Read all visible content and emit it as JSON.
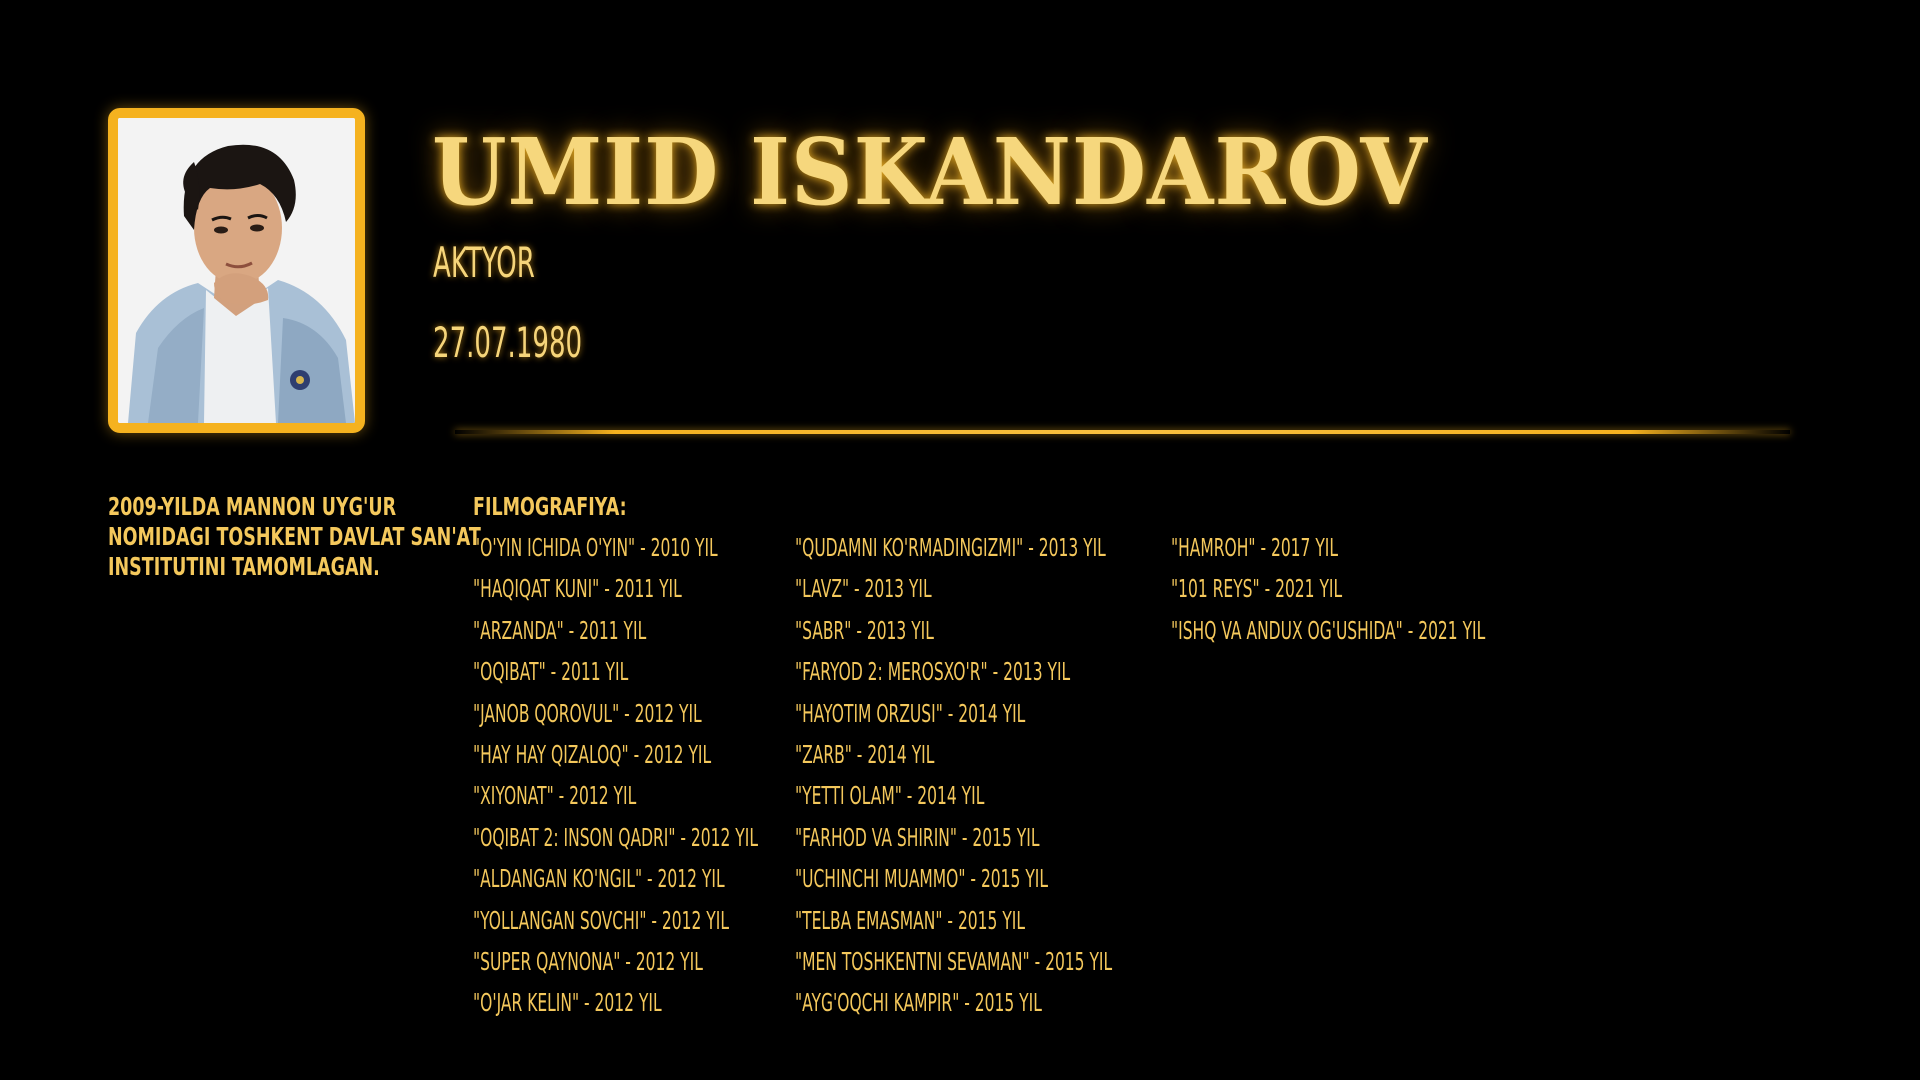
{
  "profile": {
    "name": "UMID ISKANDAROV",
    "role": "AKTYOR",
    "birth_date": "27.07.1980",
    "photo_icon": "portrait-photo"
  },
  "bio": {
    "lines": [
      "2009-YILDA MANNON UYG'UR",
      "NOMIDAGI TOSHKENT DAVLAT SAN'AT",
      "INSTITUTINI TAMOMLAGAN."
    ]
  },
  "filmography": {
    "title": "FILMOGRAFIYA:",
    "columns": [
      [
        "\"O'YIN ICHIDA O'YIN\" - 2010 YIL",
        "\"HAQIQAT KUNI\" - 2011 YIL",
        "\"ARZANDA\" - 2011 YIL",
        "\"OQIBAT\" - 2011 YIL",
        "\"JANOB QOROVUL\" - 2012 YIL",
        "\"HAY HAY QIZALOQ\" - 2012 YIL",
        "\"XIYONAT\" - 2012 YIL",
        "\"OQIBAT 2: INSON QADRI\" - 2012 YIL",
        "\"ALDANGAN KO'NGIL\" - 2012 YIL",
        "\"YOLLANGAN SOVCHI\" - 2012 YIL",
        "\"SUPER QAYNONA\" - 2012 YIL",
        "\"O'JAR KELIN\" - 2012 YIL"
      ],
      [
        "\"QUDAMNI KO'RMADINGIZMI\" - 2013 YIL",
        "\"LAVZ\" - 2013 YIL",
        "\"SABR\" - 2013 YIL",
        "\"FARYOD 2: MEROSXO'R\" - 2013 YIL",
        "\"HAYOTIM ORZUSI\" - 2014 YIL",
        "\"ZARB\" - 2014 YIL",
        "\"YETTI OLAM\" - 2014 YIL",
        "\"FARHOD VA SHIRIN\" - 2015 YIL",
        "\"UCHINCHI MUAMMO\" - 2015 YIL",
        "\"TELBA EMASMAN\" - 2015 YIL",
        "\"MEN TOSHKENTNI SEVAMAN\" - 2015 YIL",
        "\"AYG'OQCHI KAMPIR\" - 2015 YIL"
      ],
      [
        "\"HAMROH\" - 2017 YIL",
        "\"101 REYS\" - 2021 YIL",
        "\"ISHQ VA ANDUX OG'USHIDA\" - 2021 YIL"
      ]
    ]
  },
  "colors": {
    "background": "#000000",
    "accent": "#f5b21f",
    "text": "#f4c85c"
  }
}
